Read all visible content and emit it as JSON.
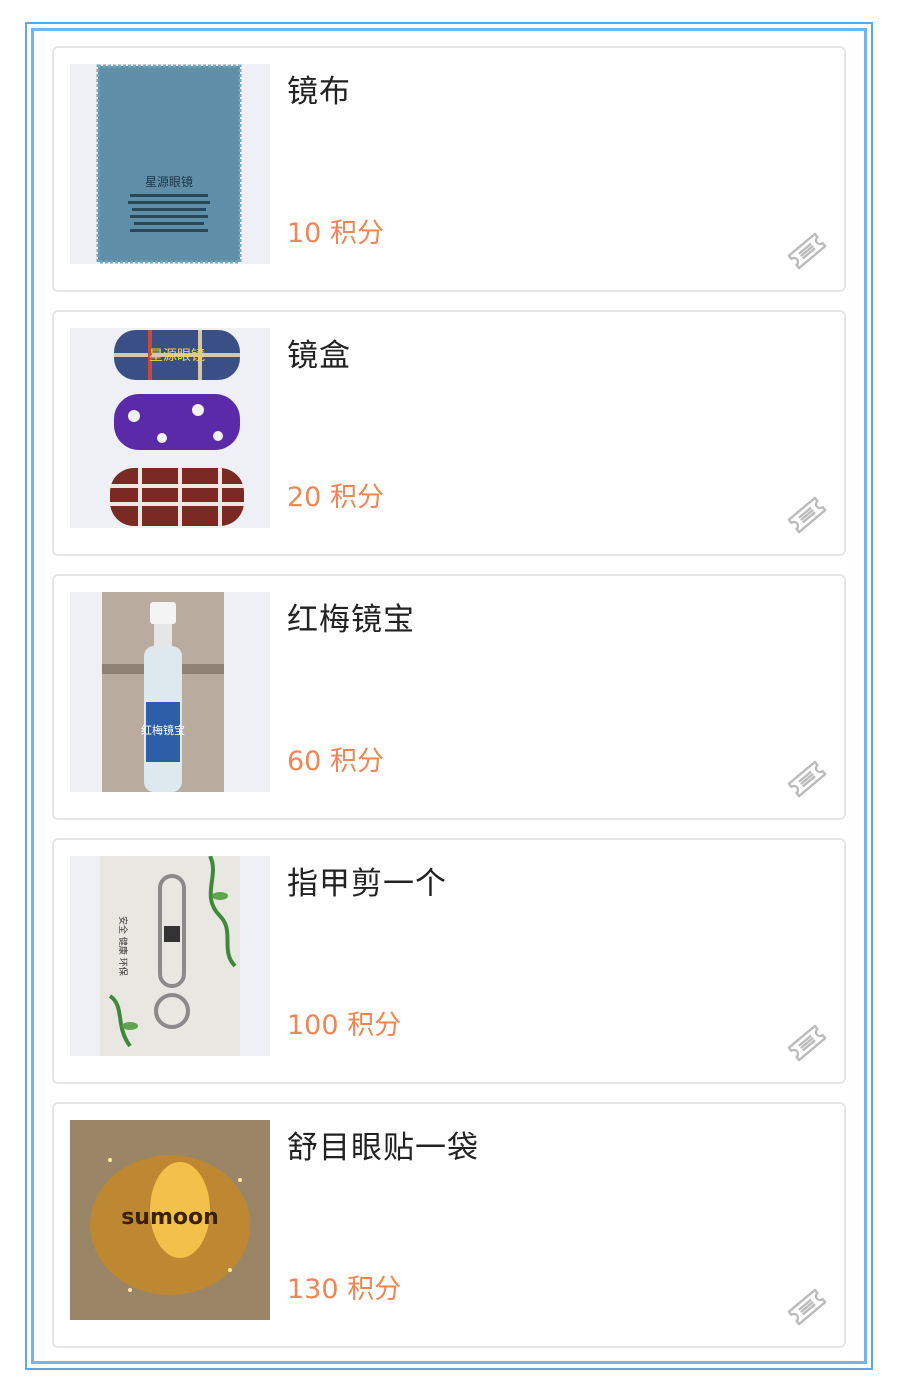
{
  "items": [
    {
      "name": "镜布",
      "points": "10 积分",
      "icon": "ticket-icon",
      "image": "lens-cloth"
    },
    {
      "name": "镜盒",
      "points": "20 积分",
      "icon": "ticket-icon",
      "image": "glasses-cases"
    },
    {
      "name": "红梅镜宝",
      "points": "60 积分",
      "icon": "ticket-icon",
      "image": "lens-spray-bottle"
    },
    {
      "name": "指甲剪一个",
      "points": "100 积分",
      "icon": "ticket-icon",
      "image": "nail-clipper"
    },
    {
      "name": "舒目眼贴一袋",
      "points": "130 积分",
      "icon": "ticket-icon",
      "image": "eye-patch-box"
    }
  ],
  "product_image_text": {
    "cloth_brand": "星源眼镜",
    "case_brand": "星源眼镜",
    "spray_brand": "红梅镜宝",
    "clipper_text": "安全 健康 环保",
    "eye_patch_brand": "sumoon"
  },
  "colors": {
    "accent_points": "#ef8653",
    "frame_blue": "#5aa7ea",
    "card_border": "#e6e6e6"
  }
}
